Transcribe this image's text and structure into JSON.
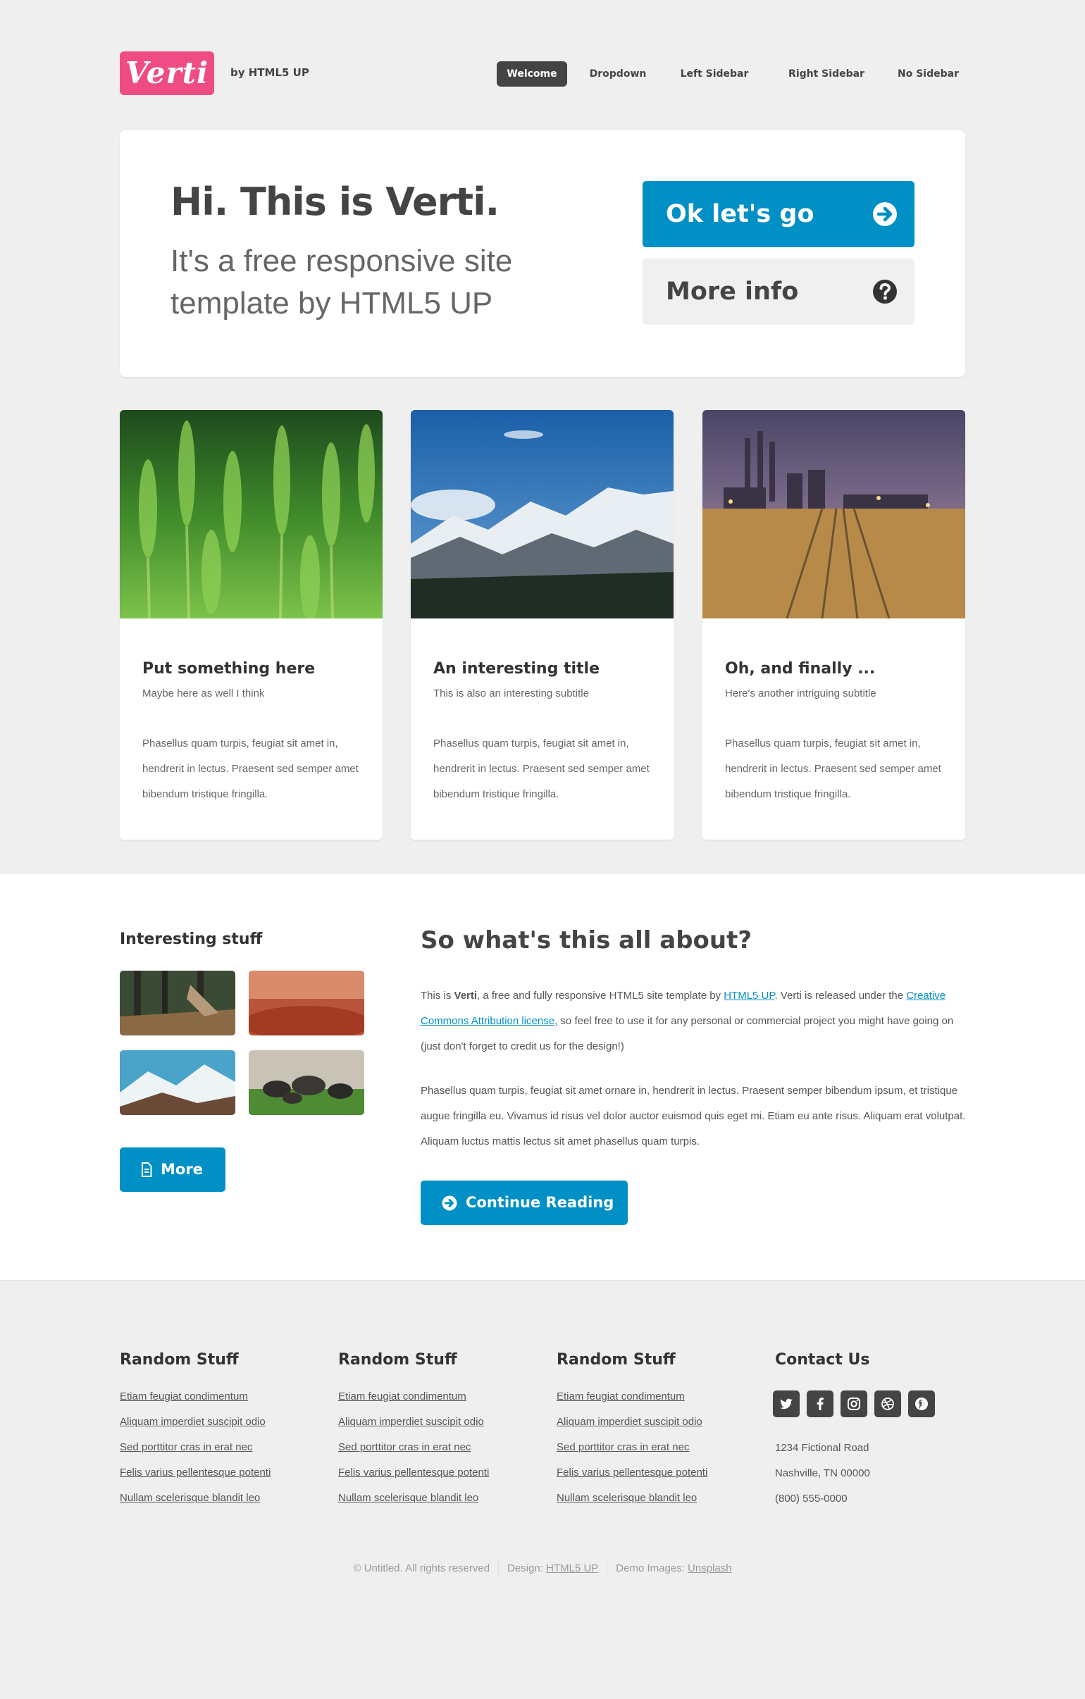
{
  "header": {
    "logo": "Verti",
    "byline": "by HTML5 UP",
    "nav": [
      {
        "label": "Welcome",
        "active": true
      },
      {
        "label": "Dropdown",
        "active": false
      },
      {
        "label": "Left Sidebar",
        "active": false
      },
      {
        "label": "Right Sidebar",
        "active": false
      },
      {
        "label": "No Sidebar",
        "active": false
      }
    ]
  },
  "banner": {
    "title": "Hi. This is Verti.",
    "subtitle": "It's a free responsive site template by HTML5 UP",
    "primary_button": "Ok let's go",
    "secondary_button": "More info"
  },
  "features": [
    {
      "title": "Put something here",
      "subtitle": "Maybe here as well I think",
      "text": "Phasellus quam turpis, feugiat sit amet in, hendrerit in lectus. Praesent sed semper amet bibendum tristique fringilla."
    },
    {
      "title": "An interesting title",
      "subtitle": "This is also an interesting subtitle",
      "text": "Phasellus quam turpis, feugiat sit amet in, hendrerit in lectus. Praesent sed semper amet bibendum tristique fringilla."
    },
    {
      "title": "Oh, and finally ...",
      "subtitle": "Here's another intriguing subtitle",
      "text": "Phasellus quam turpis, feugiat sit amet in, hendrerit in lectus. Praesent sed semper amet bibendum tristique fringilla."
    }
  ],
  "sidebar": {
    "title": "Interesting stuff",
    "more_button": "More"
  },
  "main": {
    "title": "So what's this all about?",
    "para1": {
      "t1": "This is ",
      "bold": "Verti",
      "t2": ", a free and fully responsive HTML5 site template by ",
      "link1": "HTML5 UP",
      "t3": ". Verti is released under the ",
      "link2": "Creative Commons Attribution license",
      "t4": ", so feel free to use it for any personal or commercial project you might have going on (just don't forget to credit us for the design!)"
    },
    "para2": "Phasellus quam turpis, feugiat sit amet ornare in, hendrerit in lectus. Praesent semper bibendum ipsum, et tristique augue fringilla eu. Vivamus id risus vel dolor auctor euismod quis eget mi. Etiam eu ante risus. Aliquam erat volutpat. Aliquam luctus mattis lectus sit amet phasellus quam turpis.",
    "continue_button": "Continue Reading"
  },
  "footer": {
    "link_columns": [
      {
        "title": "Random Stuff",
        "links": [
          "Etiam feugiat condimentum",
          "Aliquam imperdiet suscipit odio",
          "Sed porttitor cras in erat nec",
          "Felis varius pellentesque potenti",
          "Nullam scelerisque blandit leo"
        ]
      },
      {
        "title": "Random Stuff",
        "links": [
          "Etiam feugiat condimentum",
          "Aliquam imperdiet suscipit odio",
          "Sed porttitor cras in erat nec",
          "Felis varius pellentesque potenti",
          "Nullam scelerisque blandit leo"
        ]
      },
      {
        "title": "Random Stuff",
        "links": [
          "Etiam feugiat condimentum",
          "Aliquam imperdiet suscipit odio",
          "Sed porttitor cras in erat nec",
          "Felis varius pellentesque potenti",
          "Nullam scelerisque blandit leo"
        ]
      }
    ],
    "contact": {
      "title": "Contact Us",
      "socials": [
        "twitter-icon",
        "facebook-icon",
        "instagram-icon",
        "dribbble-icon",
        "pinterest-icon"
      ],
      "address1": "1234 Fictional Road",
      "address2": "Nashville, TN 00000",
      "phone": "(800) 555-0000"
    },
    "copyright": "© Untitled. All rights reserved",
    "design_label": "Design:",
    "design_link": "HTML5 UP",
    "images_label": "Demo Images:",
    "images_link": "Unsplash"
  },
  "colors": {
    "accent": "#0090c5",
    "logo": "#ef4c86",
    "dark": "#444444",
    "page_bg": "#efefef"
  }
}
